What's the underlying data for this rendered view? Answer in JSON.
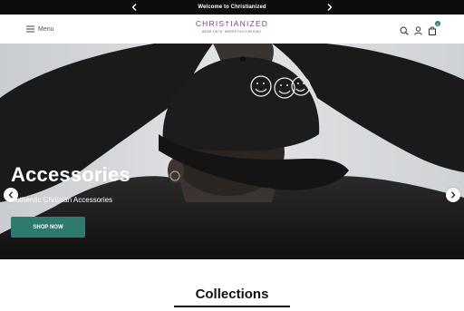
{
  "announcement": {
    "message": "Welcome to Christianized",
    "prev_icon": "chevron-left-icon",
    "next_icon": "chevron-right-icon"
  },
  "header": {
    "menu_label": "Menu",
    "logo_name": "CHRIS†IANIZED",
    "logo_tagline": "WEAR FAITH. WHERE FAITH BEGINS.",
    "icons": [
      "search-icon",
      "account-icon",
      "cart-icon"
    ],
    "cart_count": "0",
    "brand_color": "#8c3a96"
  },
  "hero": {
    "title": "Accessories",
    "subtitle": "Authentic Christian Accessories",
    "cta_label": "SHOP NOW",
    "accent_color": "#2f7a6f"
  },
  "collections": {
    "title": "Collections"
  }
}
